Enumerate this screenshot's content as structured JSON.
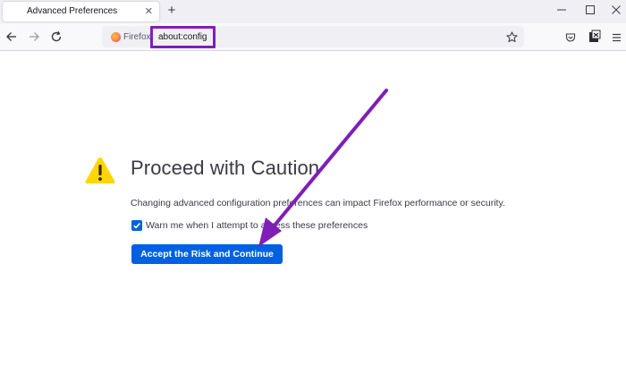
{
  "tab": {
    "title": "Advanced Preferences",
    "close_glyph": "✕"
  },
  "new_tab_glyph": "+",
  "navbar": {
    "identity_label": "Firefox",
    "url": "about:config"
  },
  "warning": {
    "title": "Proceed with Caution",
    "description": "Changing advanced configuration preferences can impact Firefox performance or security.",
    "checkbox_label": "Warn me when I attempt to access these preferences",
    "checkbox_checked": true,
    "accept_button": "Accept the Risk and Continue"
  },
  "colors": {
    "accent": "#0061e0",
    "annotation": "#7f1fb7",
    "warning": "#ffd600"
  },
  "icons": [
    "back-icon",
    "forward-icon",
    "reload-icon",
    "firefox-logo-icon",
    "bookmark-star-icon",
    "pocket-icon",
    "extension-icon",
    "menu-icon",
    "warning-icon",
    "checkmark-icon"
  ]
}
